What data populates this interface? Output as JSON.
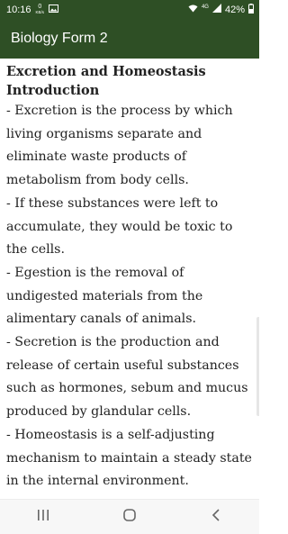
{
  "status_bar": {
    "time": "10:16",
    "data_speed_value": "0",
    "data_speed_unit": "KB/s",
    "network_type": "4G",
    "battery": "42%",
    "icons": [
      "photo-icon",
      "wifi-icon",
      "signal-icon",
      "battery-icon"
    ]
  },
  "app_bar": {
    "title": "Biology Form 2",
    "background": "#2e4f25"
  },
  "content": {
    "heading": "Excretion and Homeostasis Introduction",
    "paragraphs": [
      "- Excretion is the process by which living organisms separate and eliminate waste products of metabolism from body cells.",
      "- If these substances were left to accumulate, they would be toxic to the cells.",
      "- Egestion is the removal of undigested materials from the alimentary canals of animals.",
      "- Secretion is the production and release of certain useful substances such as hormones, sebum and mucus produced by glandular cells.",
      "- Homeostasis is a self-adjusting mechanism to maintain a steady state in the internal environment."
    ]
  },
  "nav_bar": {
    "icons": [
      "recent-apps-icon",
      "home-icon",
      "back-icon"
    ]
  }
}
